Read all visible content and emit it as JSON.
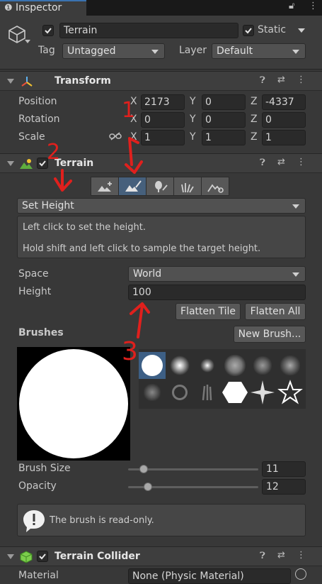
{
  "tab": {
    "title": "Inspector",
    "icon": "info-icon"
  },
  "object": {
    "name": "Terrain",
    "static_label": "Static",
    "tag_label": "Tag",
    "tag_value": "Untagged",
    "layer_label": "Layer",
    "layer_value": "Default"
  },
  "transform": {
    "title": "Transform",
    "position": {
      "label": "Position",
      "x": "2173",
      "y": "0",
      "z": "-4337"
    },
    "rotation": {
      "label": "Rotation",
      "x": "0",
      "y": "0",
      "z": "0"
    },
    "scale": {
      "label": "Scale",
      "x": "1",
      "y": "1",
      "z": "1"
    },
    "axis": {
      "x": "X",
      "y": "Y",
      "z": "Z"
    }
  },
  "terrain": {
    "title": "Terrain",
    "tool": "Set Height",
    "help_line1": "Left click to set the height.",
    "help_line2": "Hold shift and left click to sample the target height.",
    "space_label": "Space",
    "space_value": "World",
    "height_label": "Height",
    "height_value": "100",
    "flatten_tile": "Flatten Tile",
    "flatten_all": "Flatten All",
    "brushes_label": "Brushes",
    "new_brush": "New Brush...",
    "brush_size_label": "Brush Size",
    "brush_size_value": "11",
    "opacity_label": "Opacity",
    "opacity_value": "12",
    "brush_size_fraction": 0.12,
    "opacity_fraction": 0.15,
    "readonly_msg": "The brush is read-only."
  },
  "collider": {
    "title": "Terrain Collider",
    "material_label": "Material",
    "material_value": "None (Physic Material)"
  },
  "annotations": [
    "1",
    "2",
    "3"
  ],
  "colors": {
    "accent": "#3a72b0",
    "annotation": "#e0201d",
    "selected_tool": "#46607c"
  }
}
